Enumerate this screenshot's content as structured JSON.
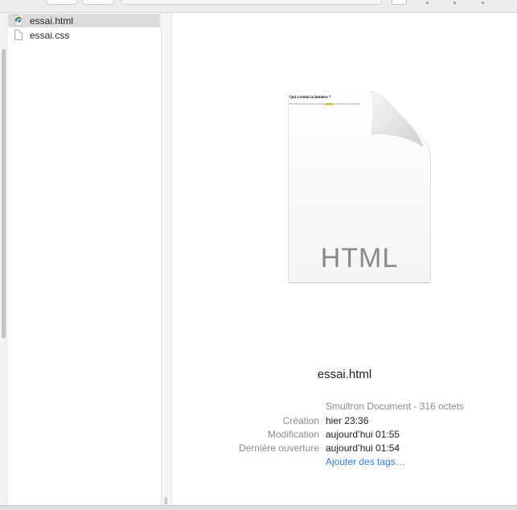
{
  "files": [
    {
      "name": "essai.html",
      "icon": "chrome-html-icon",
      "selected": true
    },
    {
      "name": "essai.css",
      "icon": "blank-document-icon",
      "selected": false
    }
  ],
  "preview": {
    "doc_heading": "Qui a éteint la lumière ?",
    "doc_text_before": "Bon il fait tout noir en ce moi, c'est lors de",
    "doc_text_highlight": "question",
    "doc_text_after": "encore parfois qu'il ne reste plus",
    "doc_type": "HTML",
    "filename": "essai.html",
    "kind": "Smultron Document - 316 octets",
    "metadata": [
      {
        "label": "Création",
        "value": "hier 23:36"
      },
      {
        "label": "Modification",
        "value": "aujourd’hui 01:55"
      },
      {
        "label": "Dernière ouverture",
        "value": "aujourd’hui 01:54"
      }
    ],
    "add_tags": "Ajouter des tags…"
  },
  "colors": {
    "selection": "#dcdcdc",
    "link": "#2f7fd6",
    "label_gray": "#8b8b8b",
    "highlight": "#f3e94a"
  },
  "divider_grip": "||"
}
